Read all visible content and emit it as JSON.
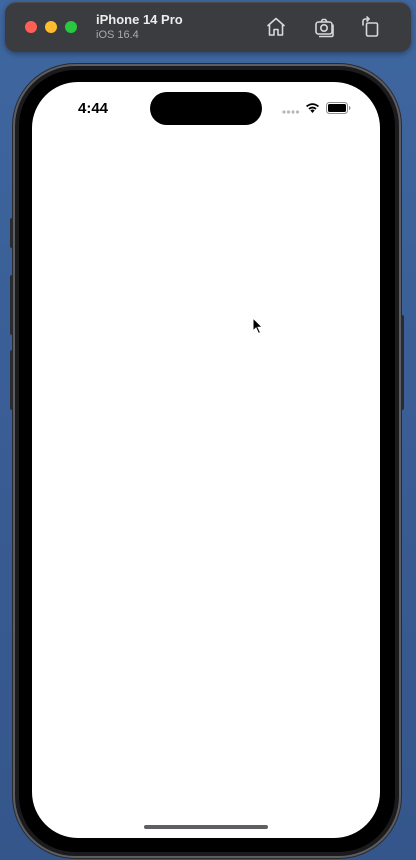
{
  "window": {
    "device_name": "iPhone 14 Pro",
    "os_version": "iOS 16.4",
    "controls": {
      "close_color": "#ff5f57",
      "minimize_color": "#febc2e",
      "maximize_color": "#28c840"
    },
    "toolbar": [
      {
        "icon": "home-icon",
        "action": "home"
      },
      {
        "icon": "screenshot-icon",
        "action": "screenshot"
      },
      {
        "icon": "rotate-icon",
        "action": "rotate"
      }
    ]
  },
  "status_bar": {
    "time": "4:44",
    "icons": [
      "cellular-signal-icon",
      "wifi-icon",
      "battery-icon"
    ]
  },
  "screen": {
    "background": "#ffffff",
    "content": ""
  },
  "colors": {
    "desktop": "#3b6096",
    "toolbar": "#3a3c40",
    "device_frame": "#1b1b1d"
  }
}
